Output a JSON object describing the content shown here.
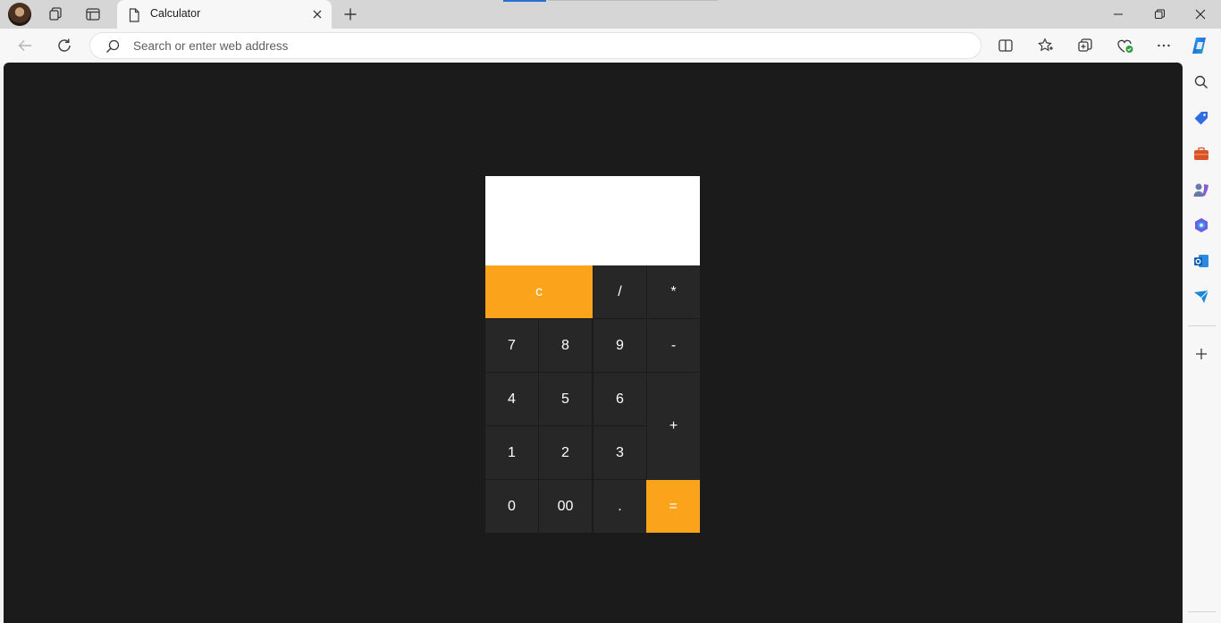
{
  "browser": {
    "tab": {
      "title": "Calculator"
    },
    "address_bar": {
      "placeholder": "Search or enter web address",
      "value": ""
    }
  },
  "calculator": {
    "display_value": "",
    "keys": {
      "clear": "c",
      "divide": "/",
      "multiply": "*",
      "seven": "7",
      "eight": "8",
      "nine": "9",
      "minus": "-",
      "four": "4",
      "five": "5",
      "six": "6",
      "plus": "+",
      "one": "1",
      "two": "2",
      "three": "3",
      "zero": "0",
      "double_zero": "00",
      "decimal": ".",
      "equals": "="
    }
  },
  "colors": {
    "page_background": "#1b1b1b",
    "key_background": "#272727",
    "accent_orange": "#fca31c",
    "display_background": "#ffffff"
  }
}
